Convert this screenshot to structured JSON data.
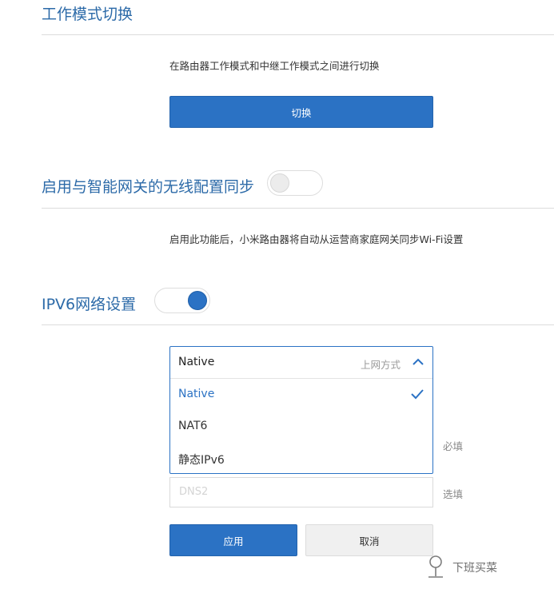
{
  "work_mode": {
    "title": "工作模式切换",
    "description": "在路由器工作模式和中继工作模式之间进行切换",
    "switch_button": "切换"
  },
  "wireless_sync": {
    "title": "启用与智能网关的无线配置同步",
    "toggle_state": "off",
    "description": "启用此功能后，小米路由器将自动从运营商家庭网关同步Wi-Fi设置"
  },
  "ipv6": {
    "title": "IPV6网络设置",
    "toggle_state": "on",
    "connection_select": {
      "value": "Native",
      "hint": "上网方式",
      "options": [
        {
          "label": "Native",
          "selected": true
        },
        {
          "label": "NAT6",
          "selected": false
        },
        {
          "label": "静态IPv6",
          "selected": false
        }
      ]
    },
    "dns1_label": "必填",
    "dns2_placeholder": "DNS2",
    "dns2_label": "选填",
    "apply_button": "应用",
    "cancel_button": "取消"
  },
  "watermark": {
    "text": "下班买菜",
    "icon": "watermark-value-icon"
  },
  "colors": {
    "accent": "#2b72c4",
    "title": "#2c6aa8",
    "divider": "#dcdcdc"
  }
}
